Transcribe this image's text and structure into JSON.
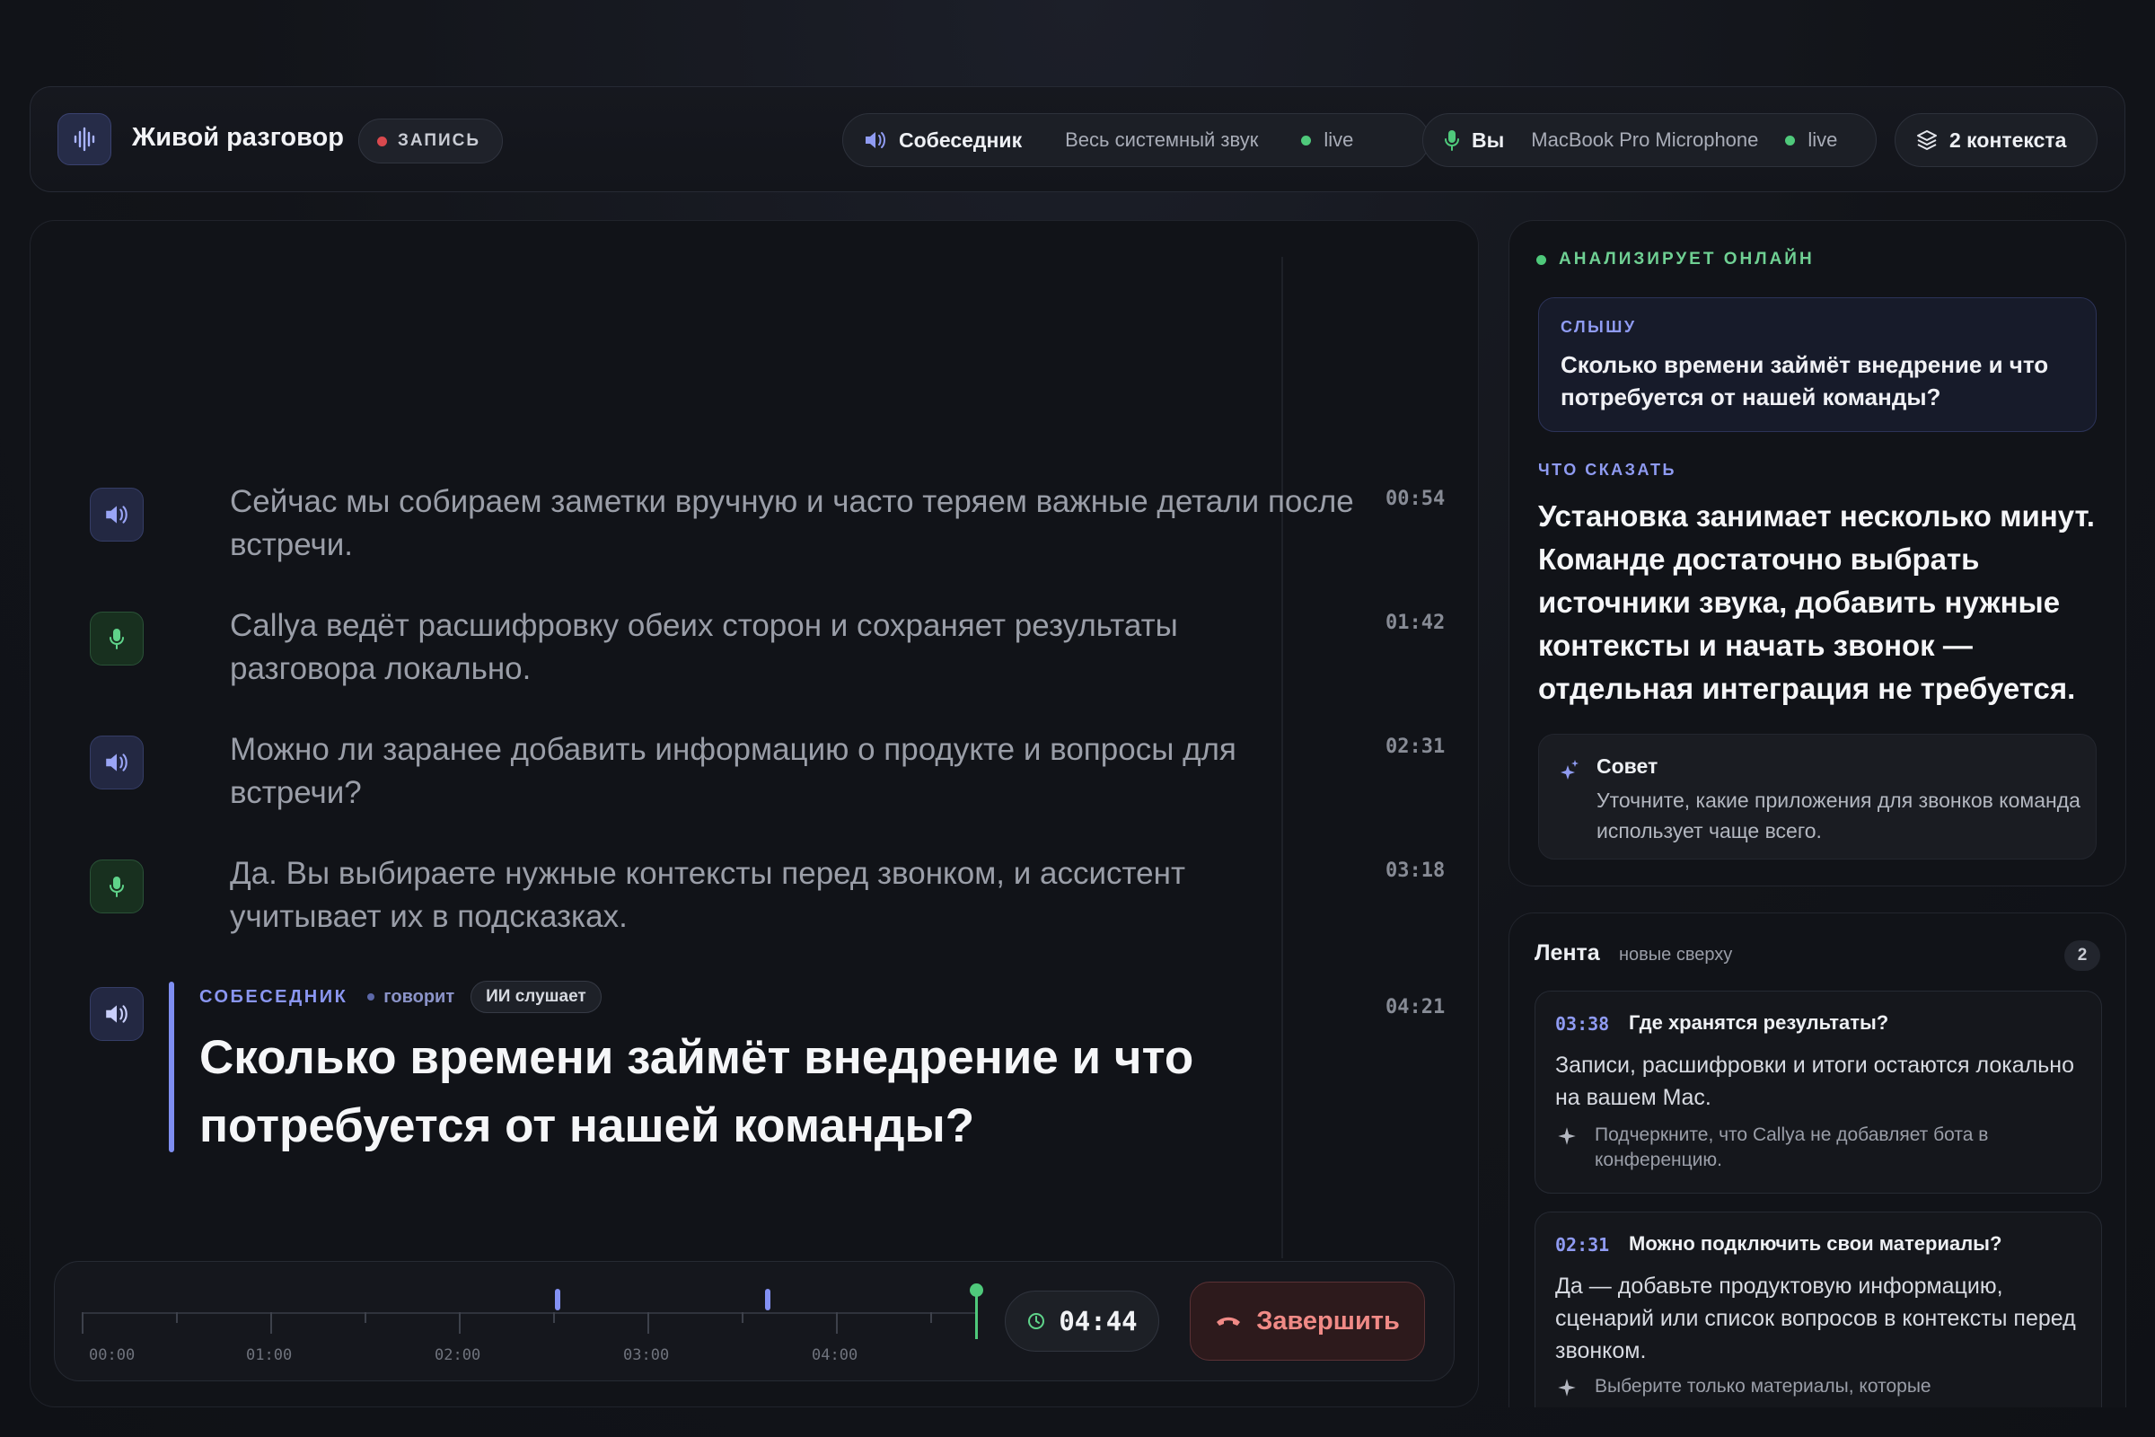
{
  "header": {
    "title": "Живой разговор",
    "record_label": "ЗАПИСЬ",
    "peer_source": {
      "label": "Собеседник",
      "device": "Весь системный звук",
      "status": "live"
    },
    "me_source": {
      "label": "Вы",
      "device": "MacBook Pro Microphone",
      "status": "live"
    },
    "contexts_label": "2 контекста"
  },
  "transcript": {
    "messages": [
      {
        "speaker": "peer",
        "text": "Сейчас мы собираем заметки вручную и часто теряем важные детали после встречи.",
        "time": "00:54"
      },
      {
        "speaker": "me",
        "text": "Callya ведёт расшифровку обеих сторон и сохраняет результаты разговора локально.",
        "time": "01:42"
      },
      {
        "speaker": "peer",
        "text": "Можно ли заранее добавить информацию о продукте и вопросы для встречи?",
        "time": "02:31"
      },
      {
        "speaker": "me",
        "text": "Да. Вы выбираете нужные контексты перед звонком, и ассистент учитывает их в подсказках.",
        "time": "03:18"
      }
    ],
    "current": {
      "speaker_label": "СОБЕСЕДНИК",
      "status": "говорит",
      "ai_badge": "ИИ слушает",
      "text": "Сколько времени займёт внедрение и что потребуется от нашей команды?",
      "time": "04:21"
    }
  },
  "timeline": {
    "ticks": [
      "00:00",
      "01:00",
      "02:00",
      "03:00",
      "04:00"
    ],
    "elapsed": "04:44",
    "end_label": "Завершить"
  },
  "assistant": {
    "status": "АНАЛИЗИРУЕТ ОНЛАЙН",
    "hear_label": "СЛЫШУ",
    "hear_text": "Сколько времени займёт внедрение и что потребуется от нашей команды?",
    "say_label": "ЧТО СКАЗАТЬ",
    "say_text": "Установка занимает несколько минут. Команде достаточно выбрать источники звука, добавить нужные контексты и начать звонок — отдельная интеграция не требуется.",
    "tip_label": "Совет",
    "tip_text": "Уточните, какие приложения для звонков команда использует чаще всего."
  },
  "feed": {
    "title": "Лента",
    "subtitle": "новые сверху",
    "count": "2",
    "items": [
      {
        "time": "03:38",
        "question": "Где хранятся результаты?",
        "answer": "Записи, расшифровки и итоги остаются локально на вашем Mac.",
        "hint": "Подчеркните, что Callya не добавляет бота в конференцию."
      },
      {
        "time": "02:31",
        "question": "Можно подключить свои материалы?",
        "answer": "Да — добавьте продуктовую информацию, сценарий или список вопросов в контексты перед звонком.",
        "hint": "Выберите только материалы, которые"
      }
    ]
  },
  "colors": {
    "accent": "#8391f4",
    "live": "#4fc97b",
    "danger": "#f08a86"
  }
}
